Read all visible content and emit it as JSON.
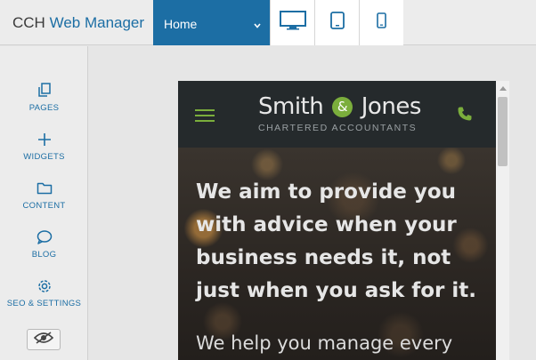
{
  "app": {
    "brand_cch": "CCH",
    "brand_rest": "Web Manager"
  },
  "page_select": {
    "value": "Home"
  },
  "devices": [
    {
      "icon": "desktop-icon",
      "active": true
    },
    {
      "icon": "tablet-icon",
      "active": false
    },
    {
      "icon": "mobile-icon",
      "active": false
    }
  ],
  "sidebar": {
    "items": [
      {
        "label": "PAGES",
        "icon": "pages-icon"
      },
      {
        "label": "WIDGETS",
        "icon": "plus-icon"
      },
      {
        "label": "CONTENT",
        "icon": "folder-icon"
      },
      {
        "label": "BLOG",
        "icon": "chat-bubble-icon"
      },
      {
        "label": "SEO & SETTINGS",
        "icon": "gear-icon"
      }
    ],
    "preview_toggle_icon": "eye-icon"
  },
  "preview": {
    "logo_smith": "Smith",
    "logo_amp": "&",
    "logo_jones": "Jones",
    "logo_subtitle": "CHARTERED ACCOUNTANTS",
    "headline": "We aim to provide you with advice when your business needs it, not just when you ask for it.",
    "subline": "We help you manage every"
  },
  "colors": {
    "accent_blue": "#1c6ea4",
    "accent_green": "#7bae3c"
  }
}
